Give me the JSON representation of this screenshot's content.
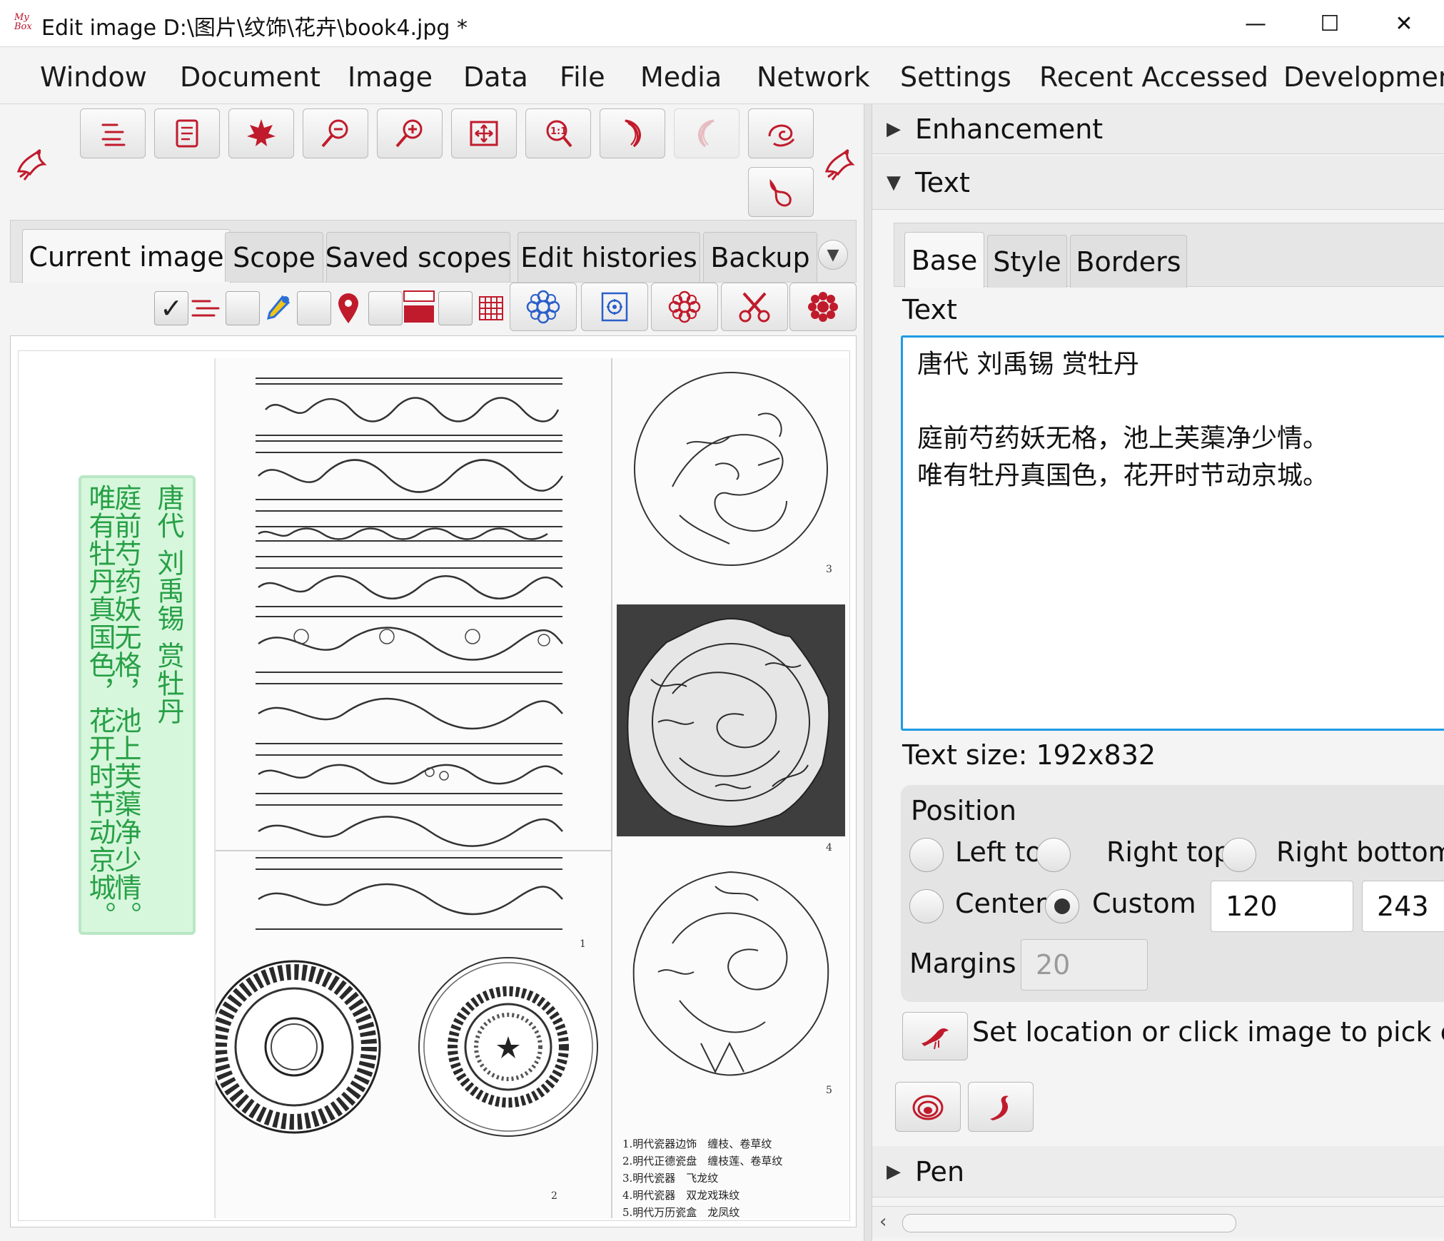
{
  "window": {
    "app_logo": "My Box",
    "title": "Edit image D:\\图片\\纹饰\\花卉\\book4.jpg  *",
    "minimize": "—",
    "maximize": "☐",
    "close": "✕"
  },
  "menu": [
    "Window",
    "Document",
    "Image",
    "Data",
    "File",
    "Media",
    "Network",
    "Settings",
    "Recent Accessed",
    "Development"
  ],
  "toolbar": {
    "icons": [
      "page-list-icon",
      "document-icon",
      "maple-leaf-icon",
      "zoom-out-icon",
      "zoom-in-icon",
      "fit-window-icon",
      "actual-size-icon",
      "rotate-left-icon",
      "rotate-right-icon",
      "swirl-icon",
      "undo-icon"
    ],
    "disabled_index": 8,
    "accent": "#c01b2c"
  },
  "left_tabs": [
    "Current image",
    "Scope",
    "Saved scopes",
    "Edit histories",
    "Backup"
  ],
  "canvas": {
    "poem_col_right": "唐代 刘禹锡 赏牡丹",
    "poem_col_1": "庭前芍药妖无格，池上芙蕖净少情。",
    "poem_col_2": "唯有牡丹真国色，花开时节动京城。",
    "figure_numbers": [
      "1",
      "2",
      "3",
      "4",
      "5"
    ],
    "captions": [
      "1.明代瓷器边饰　缠枝、卷草纹",
      "2.明代正德瓷盘　缠枝莲、卷草纹",
      "3.明代瓷器　飞龙纹",
      "4.明代瓷器　双龙戏珠纹",
      "5.明代万历瓷盒　龙凤纹"
    ],
    "text_box_color": "#d7f7dc",
    "text_color": "#27a046"
  },
  "right_panel": {
    "enhancement": "Enhancement",
    "text_section": "Text",
    "tabs": [
      "Base",
      "Style",
      "Borders"
    ],
    "text_label": "Text",
    "text_value": "唐代 刘禹锡 赏牡丹\n\n庭前芍药妖无格，池上芙蕖净少情。\n唯有牡丹真国色，花开时节动京城。",
    "text_size": "Text size: 192x832",
    "position_label": "Position",
    "positions": {
      "left_top": "Left top",
      "right_top": "Right top",
      "right_bottom": "Right bottom",
      "center": "Center",
      "custom": "Custom"
    },
    "selected_position": "Custom",
    "x_value": "120",
    "y_value": "243",
    "margins_label": "Margins",
    "margins_value": "20",
    "pick_hint": "Set location or click image to pick coordinate",
    "pen": "Pen"
  }
}
